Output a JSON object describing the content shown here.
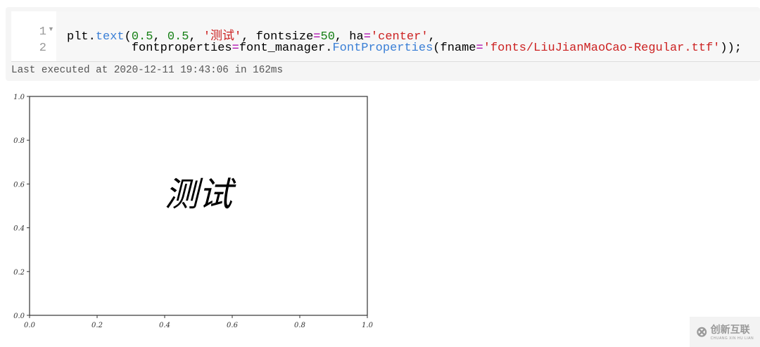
{
  "cell": {
    "line_numbers": [
      "1",
      "2"
    ],
    "line1": {
      "a": "plt.",
      "fn": "text",
      "b": "(",
      "n1": "0.5",
      "c": ", ",
      "n2": "0.5",
      "d": ", ",
      "s1": "'测试'",
      "e": ", fontsize",
      "eq1": "=",
      "n3": "50",
      "f": ", ha",
      "eq2": "=",
      "s2": "'center'",
      "g": ","
    },
    "line2": {
      "a": "         fontproperties",
      "eq": "=",
      "b": "font_manager.",
      "cls": "FontProperties",
      "c": "(fname",
      "eq2": "=",
      "s": "'fonts/LiuJianMaoCao-Regular.ttf'",
      "d": "));"
    },
    "status": "Last executed at 2020-12-11 19:43:06 in 162ms"
  },
  "chart_data": {
    "type": "scatter",
    "annotation": {
      "text": "测试",
      "x": 0.5,
      "y": 0.5,
      "ha": "center"
    },
    "xlim": [
      0,
      1
    ],
    "ylim": [
      0,
      1
    ],
    "xticks": [
      "0.0",
      "0.2",
      "0.4",
      "0.6",
      "0.8",
      "1.0"
    ],
    "yticks": [
      "0.0",
      "0.2",
      "0.4",
      "0.6",
      "0.8",
      "1.0"
    ],
    "grid": false
  },
  "watermark": {
    "title": "创新互联",
    "subtitle": "CHUANG XIN HU LIAN"
  }
}
